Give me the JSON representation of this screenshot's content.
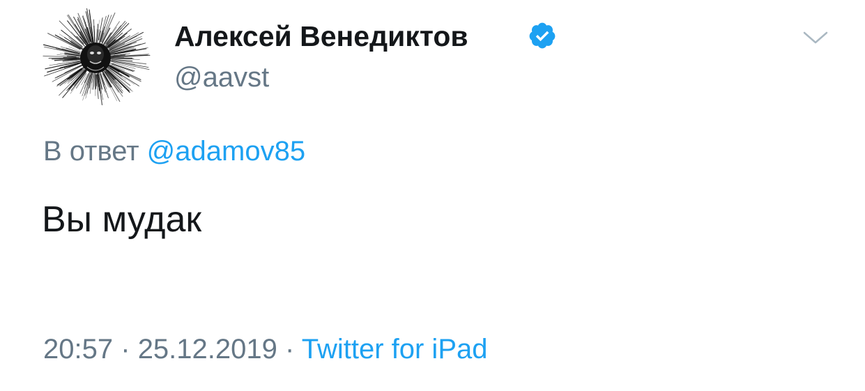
{
  "author": {
    "display_name": "Алексей Венедиктов",
    "handle": "@aavst",
    "verified": true
  },
  "reply": {
    "prefix": "В ответ",
    "mention": "@adamov85"
  },
  "tweet": {
    "text": "Вы мудак"
  },
  "meta": {
    "time": "20:57",
    "separator": "·",
    "date": "25.12.2019",
    "source": "Twitter for iPad"
  },
  "icons": {
    "verified": "verified-badge-icon",
    "menu": "chevron-down-icon",
    "avatar": "avatar-image"
  },
  "colors": {
    "text": "#14171a",
    "secondary": "#657786",
    "accent": "#1da1f2"
  }
}
